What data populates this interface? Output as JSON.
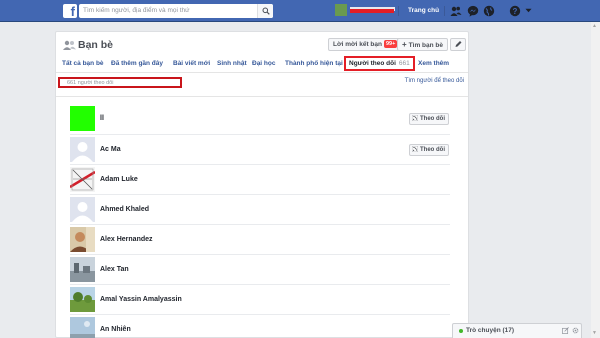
{
  "topbar": {
    "logo": "f",
    "search_placeholder": "Tìm kiếm người, địa điểm và mọi thứ",
    "home": "Trang chủ",
    "icons": [
      "friends-icon",
      "messenger-icon",
      "globe-icon",
      "help-icon",
      "chevron-down-icon"
    ]
  },
  "panel": {
    "title": "Bạn bè",
    "friend_requests_label": "Lời mời kết bạn",
    "friend_requests_badge": "99+",
    "add_friend_label": "Tìm bạn bè",
    "tabs": [
      "Tất cả bạn bè",
      "Đã thêm gần đây",
      "Bài viết mới",
      "Sinh nhật",
      "Đại học",
      "Thành phố hiện tại"
    ],
    "active_tab_label": "Người theo dõi",
    "active_tab_count": "661",
    "more_tab": "Xem thêm",
    "followers_count_text": "661 người theo dõi",
    "following_link": "Tìm người để theo dõi"
  },
  "followers": [
    {
      "name": "ll",
      "follow": "Theo dõi",
      "pic": "green"
    },
    {
      "name": "Ac Ma",
      "follow": "Theo dõi",
      "pic": "default"
    },
    {
      "name": "Adam Luke",
      "follow": "",
      "pic": "diagram"
    },
    {
      "name": "Ahmed Khaled",
      "follow": "",
      "pic": "default"
    },
    {
      "name": "Alex Hernandez",
      "follow": "",
      "pic": "photo-warm"
    },
    {
      "name": "Alex Tan",
      "follow": "",
      "pic": "photo-grey"
    },
    {
      "name": "Amal Yassin Amalyassin",
      "follow": "",
      "pic": "photo-green"
    },
    {
      "name": "An Nhiên",
      "follow": "",
      "pic": "photo-sky"
    }
  ],
  "chat": {
    "label": "Trò chuyện (17)"
  },
  "colors": {
    "brand": "#4267b2",
    "highlight": "#e41e26",
    "link": "#365899"
  }
}
